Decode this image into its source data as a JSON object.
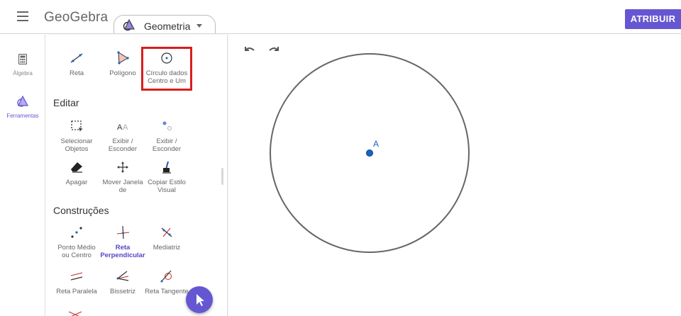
{
  "header": {
    "logo_text": "GeoGebra",
    "app_selector": {
      "label": "Geometria"
    },
    "assign_button": "ATRIBUIR"
  },
  "sidenav": {
    "items": [
      {
        "label": "Álgebra",
        "icon": "calculator-icon",
        "active": false
      },
      {
        "label": "Ferramentas",
        "icon": "tools-icon",
        "active": true
      }
    ]
  },
  "tools": {
    "top_row": [
      {
        "label": "Reta",
        "icon": "line-icon"
      },
      {
        "label": "Polígono",
        "icon": "polygon-icon"
      },
      {
        "label": "Círculo dados Centro e Um",
        "icon": "circle-center-point-icon",
        "highlighted": true
      }
    ],
    "sections": [
      {
        "title": "Editar",
        "rows": [
          [
            {
              "label": "Selecionar Objetos",
              "icon": "select-objects-icon"
            },
            {
              "label": "Exibir / Esconder",
              "icon": "show-hide-label-icon"
            },
            {
              "label": "Exibir / Esconder",
              "icon": "show-hide-object-icon"
            }
          ],
          [
            {
              "label": "Apagar",
              "icon": "eraser-icon"
            },
            {
              "label": "Mover Janela de",
              "icon": "move-graphics-icon"
            },
            {
              "label": "Copiar Estilo Visual",
              "icon": "copy-style-icon"
            }
          ]
        ]
      },
      {
        "title": "Construções",
        "rows": [
          [
            {
              "label": "Ponto Médio ou Centro",
              "icon": "midpoint-icon"
            },
            {
              "label": "Reta Perpendicular",
              "icon": "perpendicular-line-icon",
              "selected": true
            },
            {
              "label": "Mediatriz",
              "icon": "perpendicular-bisector-icon"
            }
          ],
          [
            {
              "label": "Reta Paralela",
              "icon": "parallel-line-icon"
            },
            {
              "label": "Bissetriz",
              "icon": "angle-bisector-icon"
            },
            {
              "label": "Reta Tangente",
              "icon": "tangents-icon"
            }
          ]
        ]
      }
    ]
  },
  "canvas": {
    "point_label": "A"
  },
  "colors": {
    "accent": "#6557d2",
    "highlight": "#d81e1e",
    "point": "#1565c0"
  }
}
